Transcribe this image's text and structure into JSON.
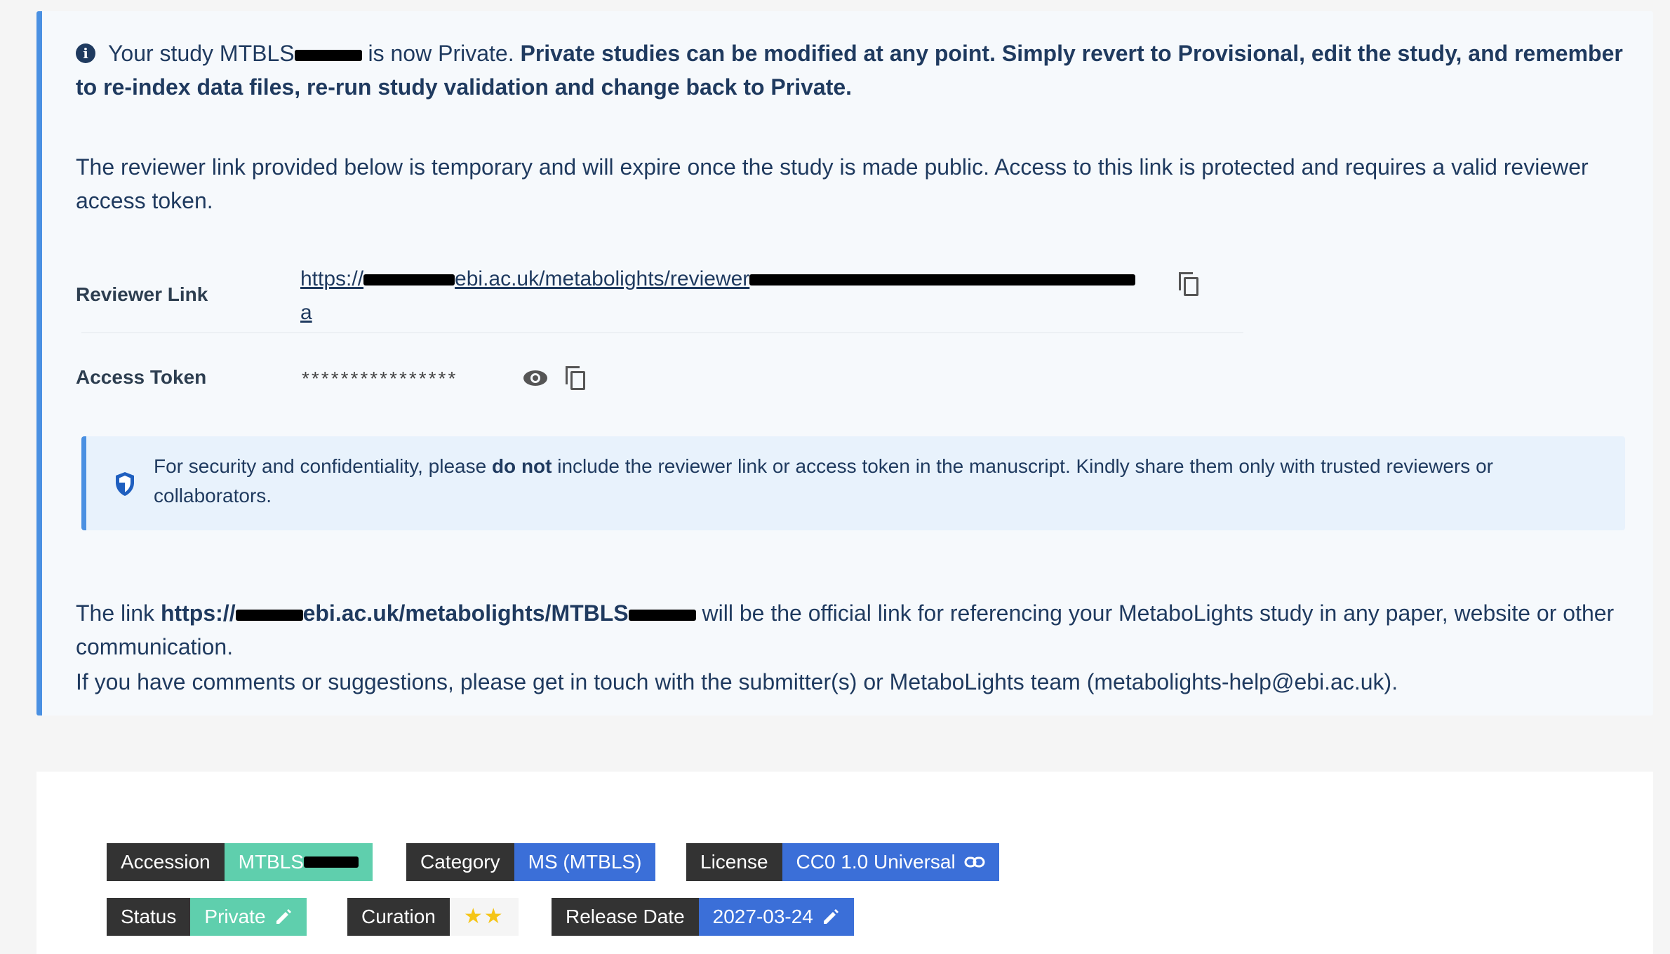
{
  "notice": {
    "line1_prefix": "Your study MTBLS",
    "line1_mid": "is now Private.",
    "line1_bold": "Private studies can be modified at any point. Simply revert to Provisional, edit the study, and remember to re-index data files, re-run study validation and change back to Private.",
    "reviewer_info": "The reviewer link provided below is temporary and will expire once the study is made public. Access to this link is protected and requires a valid reviewer access token.",
    "reviewer_link_label": "Reviewer Link",
    "reviewer_link_part1": "https://",
    "reviewer_link_part2": "ebi.ac.uk/metabolights/reviewer",
    "reviewer_link_tail": "a",
    "access_token_label": "Access Token",
    "access_token_mask": "****************",
    "security_pre": "For security and confidentiality, please",
    "security_bold": "do not",
    "security_post": "include the reviewer link or access token in the manuscript. Kindly share them only with trusted reviewers or collaborators.",
    "official_pre": "The link",
    "official_bold_a": "https://",
    "official_bold_b": "ebi.ac.uk/metabolights/MTBLS",
    "official_post": "will be the official link for referencing your MetaboLights study in any paper, website or other communication.",
    "contact": "If you have comments or suggestions, please get in touch with the submitter(s) or MetaboLights team (metabolights-help@ebi.ac.uk)."
  },
  "tags": {
    "accession_key": "Accession",
    "accession_value": "MTBLS",
    "category_key": "Category",
    "category_value": "MS (MTBLS)",
    "license_key": "License",
    "license_value": "CC0 1.0 Universal",
    "status_key": "Status",
    "status_value": "Private",
    "curation_key": "Curation",
    "curation_value": "★★",
    "release_key": "Release Date",
    "release_value": "2027-03-24"
  },
  "colors": {
    "accent_blue": "#4a90e2",
    "teal": "#5fcfad",
    "blue_tag": "#3b6fd8",
    "dark_tag": "#333333",
    "star": "#f5c518"
  }
}
